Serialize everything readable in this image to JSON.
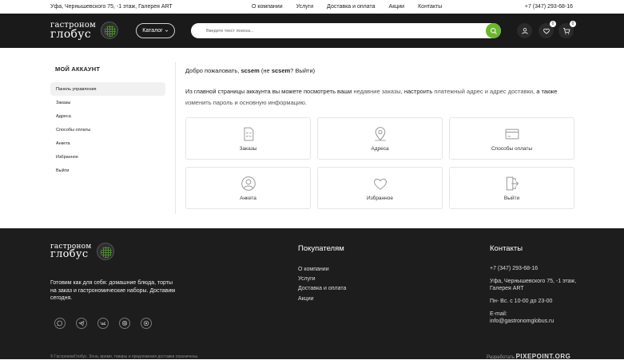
{
  "topbar": {
    "address": "Уфа, Чернышевского 75, -1 этаж, Галерея ART",
    "nav": [
      "О компании",
      "Услуги",
      "Доставка и оплата",
      "Акции",
      "Контакты"
    ],
    "phone": "+7 (347) 293-68-16"
  },
  "header": {
    "logo_line1": "гастроном",
    "logo_line2": "глобус",
    "catalog_label": "Каталог",
    "search_placeholder": "Введите текст поиска...",
    "favorites_count": "0",
    "cart_count": "0"
  },
  "sidebar": {
    "title": "МОЙ АККАУНТ",
    "items": [
      "Панель управления",
      "Заказы",
      "Адреса",
      "Способы оплаты",
      "Анкета",
      "Избранное",
      "Выйти"
    ]
  },
  "content": {
    "welcome_prefix": "Добро пожаловать,",
    "username": "scsem",
    "welcome_not": "(не",
    "username2": "scsem",
    "welcome_q": "?",
    "logout_link": "Выйти",
    "welcome_close": ")",
    "desc_1": "Из главной страницы аккаунта вы можете посмотреть ваши",
    "desc_link1": "недавние заказы",
    "desc_2": ", настроить",
    "desc_link2": "платежный адрес и адрес доставки",
    "desc_3": ", а также",
    "desc_link3": "изменить пароль и основную информацию",
    "desc_4": ".",
    "cards": [
      "Заказы",
      "Адреса",
      "Способы оплаты",
      "Анкета",
      "Избранное",
      "Выйти"
    ]
  },
  "footer": {
    "tagline": "Готовим как для себя: домашние блюда, торты на заказ и гастрономические наборы. Доставим сегодня.",
    "buyers_title": "Покупателям",
    "buyers_links": [
      "О компании",
      "Услуги",
      "Доставка и оплата",
      "Акции"
    ],
    "contacts_title": "Контакты",
    "contacts_phone": "+7 (347) 293-68-16",
    "contacts_address": "Уфа, Чернышевского 75, -1 этаж, Галерея ART",
    "contacts_hours": "Пн- Вс. с 10-00 до 23-00",
    "contacts_email_label": "E-mail:",
    "contacts_email": "info@gastronomglobus.ru",
    "copyright": "© ГастрономГлобус. Зона, время, товары и предложения доставки ограничены.",
    "dev_label": "Разработать",
    "dev_brand": "PIXEPOINT.ORG"
  },
  "colors": {
    "accent": "#6cb52d",
    "header_bg": "#1a1a1a",
    "footer_bg": "#1d1d1d"
  }
}
